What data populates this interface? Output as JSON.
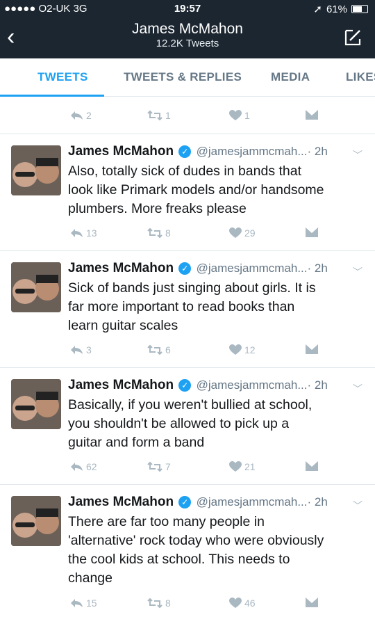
{
  "status_bar": {
    "carrier": "●●●●● O2-UK  3G",
    "time": "19:57",
    "battery": "61%"
  },
  "header": {
    "title": "James McMahon",
    "subtitle": "12.2K Tweets"
  },
  "tabs": [
    "TWEETS",
    "TWEETS & REPLIES",
    "MEDIA",
    "LIKES"
  ],
  "top_actions": {
    "replies": "2",
    "retweets": "1",
    "likes": "1"
  },
  "tweets": [
    {
      "name": "James McMahon",
      "handle": "@jamesjammcmah...",
      "time": "· 2h",
      "text": [
        "Also, totally sick of dudes in bands that",
        "look like Primark models and/or handsome",
        "plumbers. More freaks please"
      ],
      "replies": "13",
      "retweets": "8",
      "likes": "29"
    },
    {
      "name": "James McMahon",
      "handle": "@jamesjammcmah...",
      "time": "· 2h",
      "text": [
        "Sick of bands just singing about girls. It is",
        "far more important to read books than",
        "learn guitar scales"
      ],
      "replies": "3",
      "retweets": "6",
      "likes": "12"
    },
    {
      "name": "James McMahon",
      "handle": "@jamesjammcmah...",
      "time": "· 2h",
      "text": [
        "Basically, if you weren't bullied at school,",
        "you shouldn't be allowed to pick up a",
        "guitar and form a band"
      ],
      "replies": "62",
      "retweets": "7",
      "likes": "21"
    },
    {
      "name": "James McMahon",
      "handle": "@jamesjammcmah...",
      "time": "· 2h",
      "text": [
        "There are far too many people in",
        "'alternative' rock today who were obviously",
        "the cool kids at school. This needs to",
        "change"
      ],
      "replies": "15",
      "retweets": "8",
      "likes": "46"
    }
  ]
}
